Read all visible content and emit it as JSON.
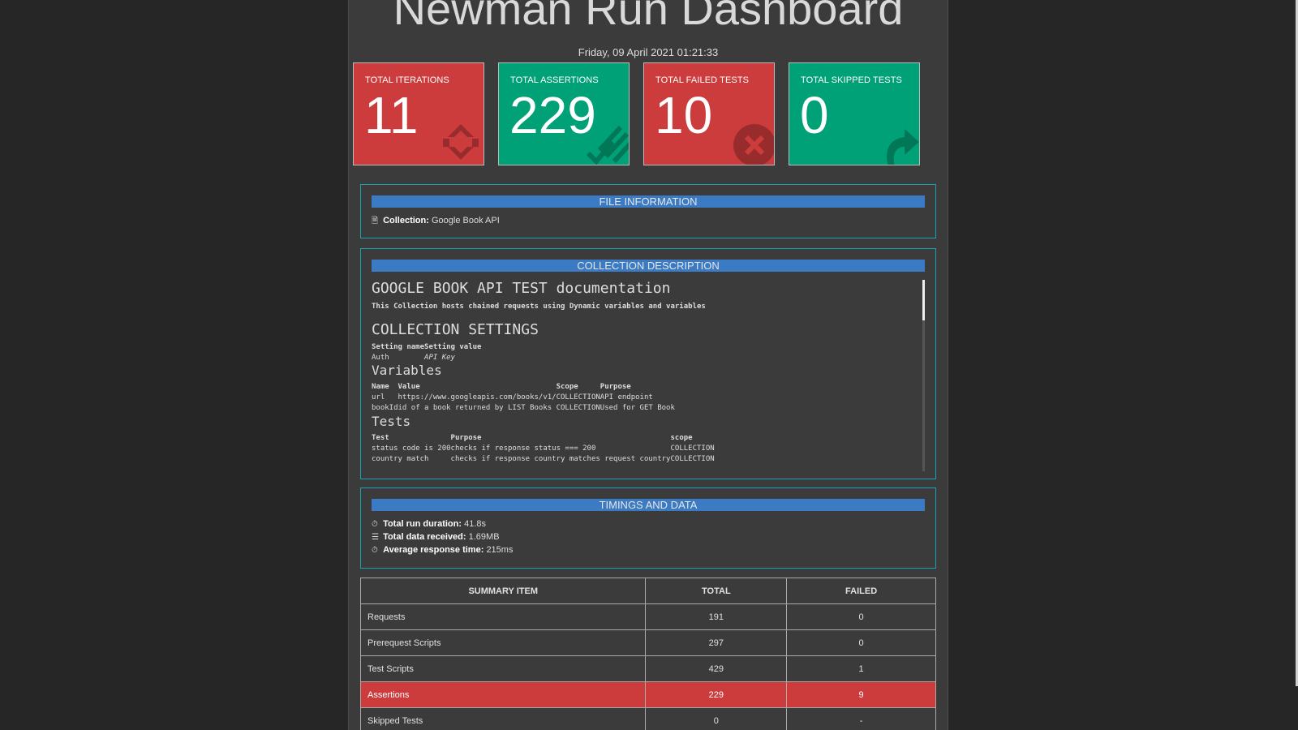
{
  "header": {
    "title": "Newman Run Dashboard",
    "date": "Friday, 09 April 2021 01:21:33"
  },
  "cards": [
    {
      "label": "TOTAL ITERATIONS",
      "value": "11",
      "color": "#cd3c3c",
      "icon": "sync-icon"
    },
    {
      "label": "TOTAL ASSERTIONS",
      "value": "229",
      "color": "#00a177",
      "icon": "tasks-icon"
    },
    {
      "label": "TOTAL FAILED TESTS",
      "value": "10",
      "color": "#cd3c3c",
      "icon": "times-circle-icon"
    },
    {
      "label": "TOTAL SKIPPED TESTS",
      "value": "0",
      "color": "#00a177",
      "icon": "share-icon"
    }
  ],
  "file_info": {
    "heading": "FILE INFORMATION",
    "collection_label": "Collection:",
    "collection_value": "Google Book API"
  },
  "description": {
    "heading": "COLLECTION DESCRIPTION",
    "doc_title": "GOOGLE BOOK API TEST documentation",
    "intro": "This Collection hosts chained requests using Dynamic variables and variables",
    "settings_title": "COLLECTION SETTINGS",
    "settings_headers": [
      "Setting name",
      "Setting value"
    ],
    "settings_rows": [
      [
        "Auth",
        "API Key"
      ]
    ],
    "variables_title": "Variables",
    "variables_headers": [
      "Name",
      "Value",
      "Scope",
      "Purpose"
    ],
    "variables_rows": [
      [
        "url",
        "https://www.googleapis.com/books/v1/",
        "COLLECTION",
        "API endpoint"
      ],
      [
        "bookId",
        "id of a book returned by LIST Books",
        "COLLECTION",
        "Used for GET Book"
      ]
    ],
    "tests_title": "Tests",
    "tests_headers": [
      "Test",
      "Purpose",
      "scope"
    ],
    "tests_rows": [
      [
        "status code is 200",
        "checks if response status === 200",
        "COLLECTION"
      ],
      [
        "country match",
        "checks if response country matches request country",
        "COLLECTION"
      ]
    ]
  },
  "timings": {
    "heading": "TIMINGS AND DATA",
    "duration_label": "Total run duration:",
    "duration_value": "41.8s",
    "data_label": "Total data received:",
    "data_value": "1.69MB",
    "response_label": "Average response time:",
    "response_value": "215ms"
  },
  "summary": {
    "headers": [
      "SUMMARY ITEM",
      "TOTAL",
      "FAILED"
    ],
    "rows": [
      {
        "item": "Requests",
        "total": "191",
        "failed": "0"
      },
      {
        "item": "Prerequest Scripts",
        "total": "297",
        "failed": "0"
      },
      {
        "item": "Test Scripts",
        "total": "429",
        "failed": "1"
      },
      {
        "item": "Assertions",
        "total": "229",
        "failed": "9"
      },
      {
        "item": "Skipped Tests",
        "total": "0",
        "failed": "-"
      }
    ]
  }
}
